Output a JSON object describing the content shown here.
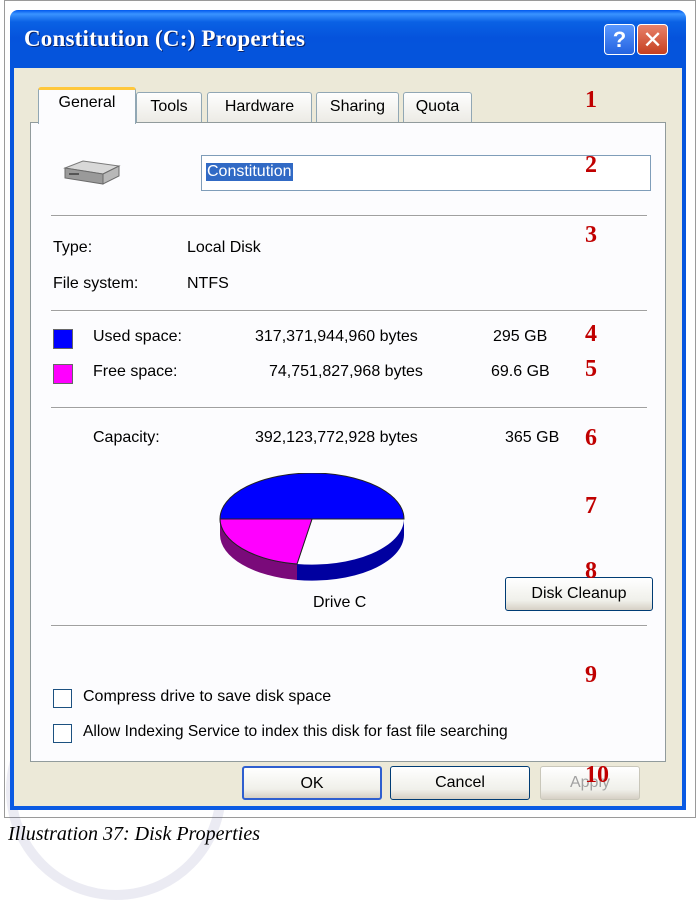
{
  "window": {
    "title": "Constitution (C:) Properties",
    "help_glyph": "?",
    "close_glyph": "✕"
  },
  "tabs": [
    {
      "label": "General",
      "active": true
    },
    {
      "label": "Tools"
    },
    {
      "label": "Hardware"
    },
    {
      "label": "Sharing"
    },
    {
      "label": "Quota"
    }
  ],
  "general": {
    "drive_name": "Constitution",
    "type_label": "Type:",
    "type_value": "Local Disk",
    "fs_label": "File system:",
    "fs_value": "NTFS",
    "used": {
      "label": "Used space:",
      "bytes": "317,371,944,960 bytes",
      "size": "295 GB",
      "color": "#0000ff"
    },
    "free": {
      "label": "Free space:",
      "bytes": "74,751,827,968 bytes",
      "size": "69.6 GB",
      "color": "#ff00ff"
    },
    "capacity": {
      "label": "Capacity:",
      "bytes": "392,123,772,928 bytes",
      "size": "365 GB"
    },
    "drive_label": "Drive C",
    "cleanup_label": "Disk Cleanup",
    "compress_label": "Compress drive to save disk space",
    "index_label": "Allow Indexing Service to index this disk for fast file searching"
  },
  "buttons": {
    "ok": "OK",
    "cancel": "Cancel",
    "apply": "Apply"
  },
  "annotations": [
    "1",
    "2",
    "3",
    "4",
    "5",
    "6",
    "7",
    "8",
    "9",
    "10"
  ],
  "caption": "Illustration 37: Disk Properties"
}
